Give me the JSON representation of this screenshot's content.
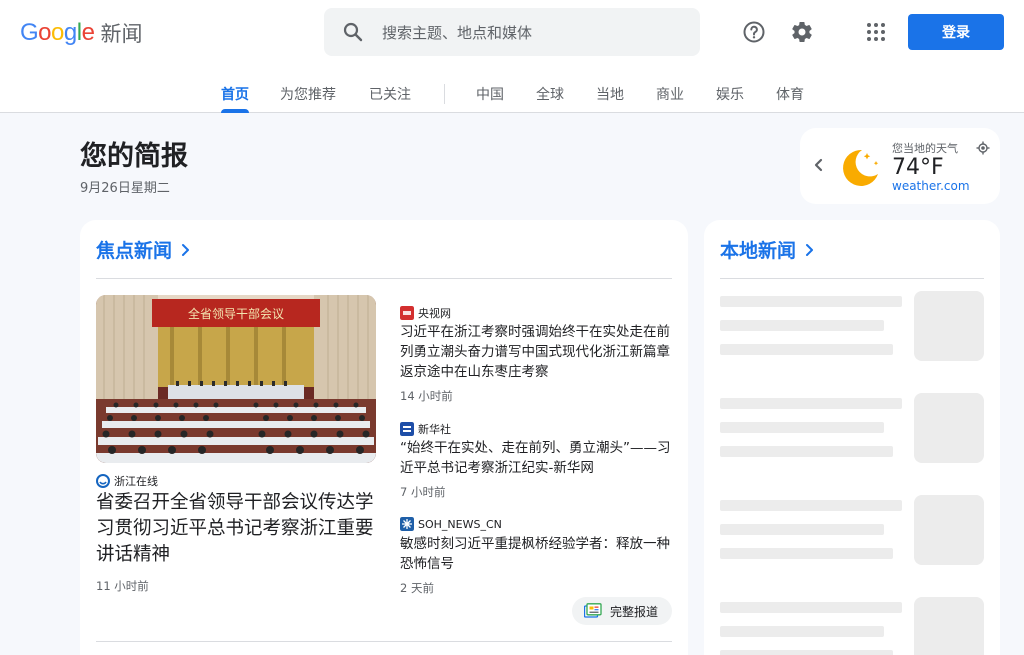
{
  "header": {
    "logo_word": "Google",
    "logo_letters": [
      {
        "ch": "G",
        "color": "#4285f4"
      },
      {
        "ch": "o",
        "color": "#ea4335"
      },
      {
        "ch": "o",
        "color": "#fbbc05"
      },
      {
        "ch": "g",
        "color": "#4285f4"
      },
      {
        "ch": "l",
        "color": "#34a853"
      },
      {
        "ch": "e",
        "color": "#ea4335"
      }
    ],
    "logo_suffix": "新闻",
    "search_placeholder": "搜索主题、地点和媒体",
    "help_icon": "help-icon",
    "settings_icon": "settings-icon",
    "apps_icon": "apps-grid-icon",
    "login_label": "登录"
  },
  "tabs": [
    {
      "label": "首页",
      "active": true
    },
    {
      "label": "为您推荐"
    },
    {
      "label": "已关注"
    },
    {
      "label": "中国"
    },
    {
      "label": "全球"
    },
    {
      "label": "当地"
    },
    {
      "label": "商业"
    },
    {
      "label": "娱乐"
    },
    {
      "label": "体育"
    }
  ],
  "briefing": {
    "title": "您的简报",
    "date": "9月26日星期二"
  },
  "weather": {
    "label": "您当地的天气",
    "temperature": "74°F",
    "source": "weather.com",
    "icon": "moon-night-icon"
  },
  "top_stories": {
    "title": "焦点新闻",
    "hero": {
      "source": "浙江在线",
      "headline": "省委召开全省领导干部会议传达学习贯彻习近平总书记考察浙江重要讲话精神",
      "time": "11 小时前",
      "banner_text": "全省领导干部会议"
    },
    "side_articles": [
      {
        "source": "央视网",
        "headline": "习近平在浙江考察时强调始终干在实处走在前列勇立潮头奋力谱写中国式现代化浙江新篇章返京途中在山东枣庄考察",
        "time": "14 小时前"
      },
      {
        "source": "新华社",
        "headline": "“始终干在实处、走在前列、勇立潮头”——习近平总书记考察浙江纪实-新华网",
        "time": "7 小时前"
      },
      {
        "source": "SOH_NEWS_CN",
        "headline": "敏感时刻习近平重提枫桥经验学者：释放一种恐怖信号",
        "time": "2 天前"
      }
    ],
    "full_coverage_label": "完整报道"
  },
  "local_news": {
    "title": "本地新闻"
  },
  "colors": {
    "accent": "#1a73e8",
    "moon": "#f9ab00"
  }
}
